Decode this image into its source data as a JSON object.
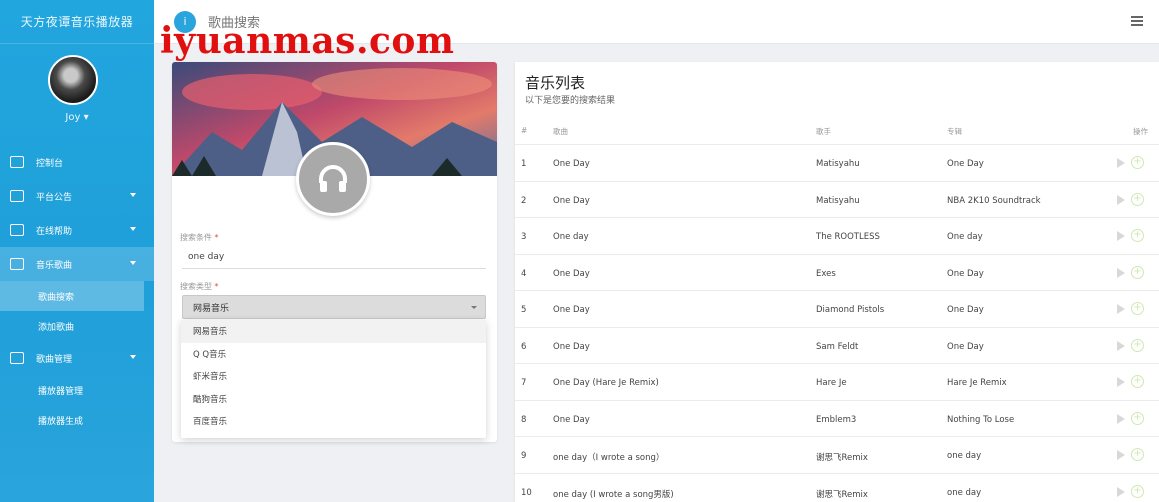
{
  "brand": "天方夜谭音乐播放器",
  "user": {
    "name": "Joy ▾"
  },
  "nav": [
    {
      "label": "控制台",
      "icon": "home-icon"
    },
    {
      "label": "平台公告",
      "icon": "notice-icon"
    },
    {
      "label": "在线帮助",
      "icon": "help-icon"
    },
    {
      "label": "音乐歌曲",
      "icon": "music-icon"
    },
    {
      "label": "歌曲搜索",
      "sub": true
    },
    {
      "label": "添加歌曲",
      "sub": true
    },
    {
      "label": "歌曲管理",
      "icon": "list-icon"
    },
    {
      "label": "播放器管理",
      "sub": true
    },
    {
      "label": "播放器生成",
      "sub": true
    }
  ],
  "topbar": {
    "icon_label": "i",
    "title": "歌曲搜索",
    "watermark": "iyuanmas.com"
  },
  "search": {
    "keyword_label": "搜索条件",
    "keyword_value": "one day",
    "type_label": "搜索类型",
    "type_selected": "网易音乐",
    "required_mark": "*",
    "options": [
      "网易音乐",
      "Q Q音乐",
      "虾米音乐",
      "酷狗音乐",
      "百度音乐"
    ]
  },
  "list": {
    "title": "音乐列表",
    "subtitle": "以下是您要的搜索结果",
    "columns": [
      "#",
      "歌曲",
      "歌手",
      "专辑",
      "操作"
    ],
    "rows": [
      [
        "1",
        "One Day",
        "Matisyahu",
        "One Day"
      ],
      [
        "2",
        "One Day",
        "Matisyahu",
        "NBA 2K10 Soundtrack"
      ],
      [
        "3",
        "One day",
        "The ROOTLESS",
        "One day"
      ],
      [
        "4",
        "One Day",
        "Exes",
        "One Day"
      ],
      [
        "5",
        "One Day",
        "Diamond Pistols",
        "One Day"
      ],
      [
        "6",
        "One Day",
        "Sam Feldt",
        "One Day"
      ],
      [
        "7",
        "One Day (Hare Je Remix)",
        "Hare Je",
        "Hare Je Remix"
      ],
      [
        "8",
        "One Day",
        "Emblem3",
        "Nothing To Lose"
      ],
      [
        "9",
        "one day（I wrote a song）",
        "谢思飞Remix",
        "one day"
      ],
      [
        "10",
        "one day (I wrote a song男版)",
        "谢思飞Remix",
        "one day"
      ]
    ]
  },
  "colors": {
    "accent": "#22a6de",
    "watermark": "#e01010"
  }
}
